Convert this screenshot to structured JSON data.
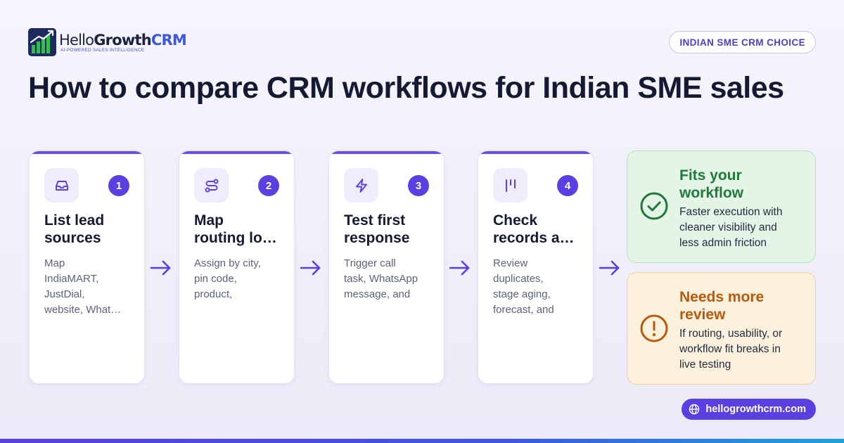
{
  "brand": {
    "name_parts": [
      "Hello",
      "Growth",
      "CRM"
    ],
    "tagline": "AI-POWERED SALES INTELLIGENCE",
    "accent": "#5b3fe0"
  },
  "badge": "INDIAN SME CRM CHOICE",
  "title": "How to compare CRM workflows for Indian SME sales",
  "steps": [
    {
      "number": "1",
      "icon": "inbox-icon",
      "title_lines": [
        "List lead",
        "sources"
      ],
      "desc_lines": [
        "Map",
        "IndiaMART,",
        "JustDial,",
        "website, What…"
      ]
    },
    {
      "number": "2",
      "icon": "route-icon",
      "title_lines": [
        "Map",
        "routing lo…"
      ],
      "desc_lines": [
        "Assign by city,",
        "pin code,",
        "product,"
      ]
    },
    {
      "number": "3",
      "icon": "lightning-icon",
      "title_lines": [
        "Test first",
        "response"
      ],
      "desc_lines": [
        "Trigger call",
        "task, WhatsApp",
        "message, and"
      ]
    },
    {
      "number": "4",
      "icon": "kanban-icon",
      "title_lines": [
        "Check",
        "records a…"
      ],
      "desc_lines": [
        "Review",
        "duplicates,",
        "stage aging,",
        "forecast, and"
      ]
    }
  ],
  "outcomes": {
    "fit": {
      "icon": "check-circle-icon",
      "title_lines": [
        "Fits your",
        "workflow"
      ],
      "desc_lines": [
        "Faster execution with",
        "cleaner visibility and",
        "less admin friction"
      ],
      "color": "#1e7a3a"
    },
    "review": {
      "icon": "alert-circle-icon",
      "title_lines": [
        "Needs more",
        "review"
      ],
      "desc_lines": [
        "If routing, usability, or",
        "workflow fit breaks in",
        "live testing"
      ],
      "color": "#b85a0c"
    }
  },
  "footer_url": "hellogrowthcrm.com"
}
